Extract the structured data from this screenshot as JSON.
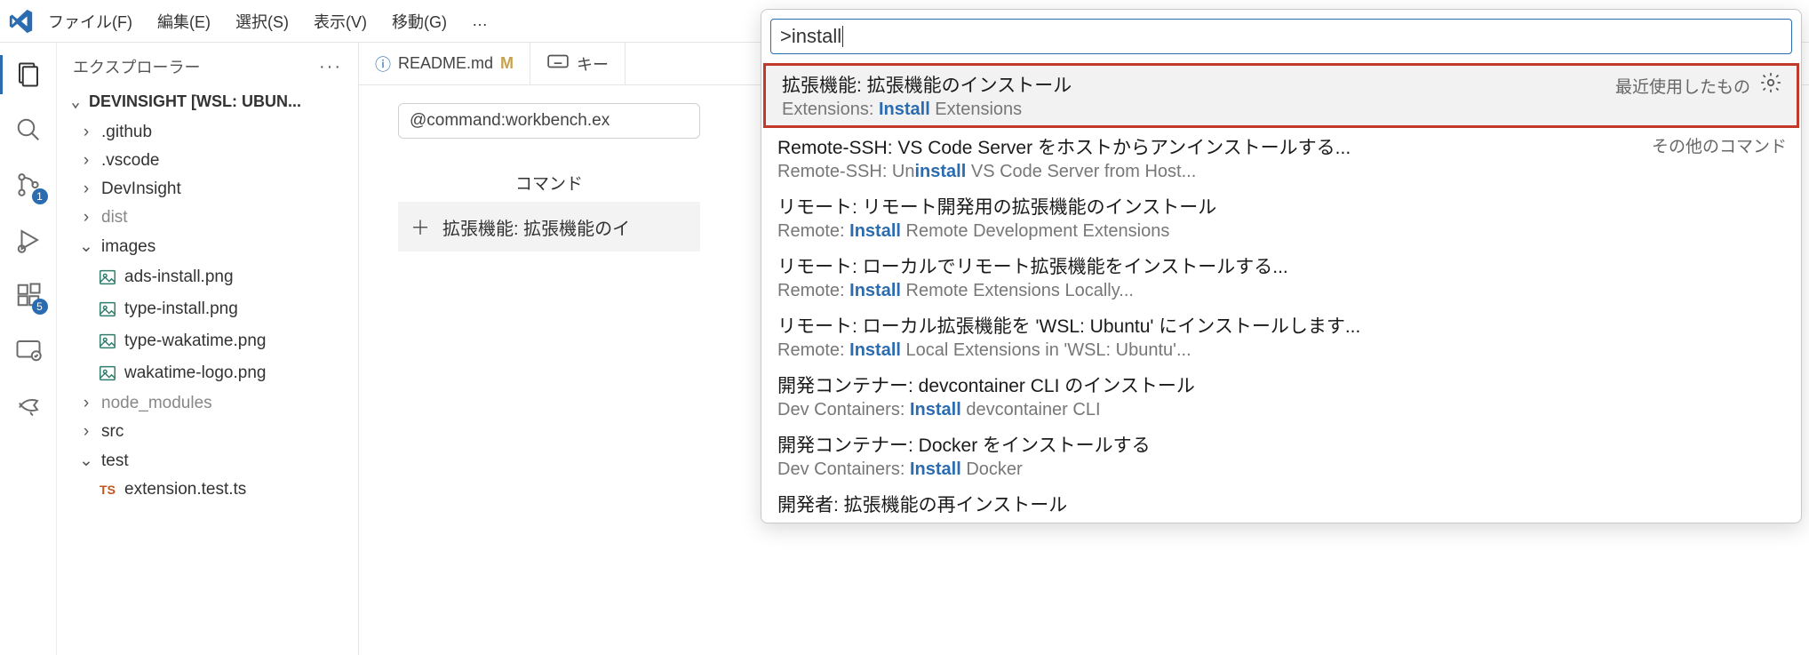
{
  "menu": {
    "file": "ファイル(F)",
    "edit": "編集(E)",
    "select": "選択(S)",
    "view": "表示(V)",
    "go": "移動(G)",
    "more": "…"
  },
  "activity": {
    "scm_badge": "1",
    "ext_badge": "5"
  },
  "sidebar": {
    "title": "エクスプローラー",
    "section": "DEVINSIGHT [WSL: UBUN...",
    "tree": {
      "github": ".github",
      "vscode": ".vscode",
      "devinsight": "DevInsight",
      "dist": "dist",
      "images": "images",
      "img1": "ads-install.png",
      "img2": "type-install.png",
      "img3": "type-wakatime.png",
      "img4": "wakatime-logo.png",
      "node_modules": "node_modules",
      "src": "src",
      "test": "test",
      "testfile": "extension.test.ts",
      "testfile_badge": "TS"
    }
  },
  "tabs": {
    "readme": "README.md",
    "readme_m": "M",
    "shortcuts": "キー"
  },
  "editor": {
    "filter": "@command:workbench.ex",
    "cmd_header": "コマンド",
    "cmd_row": "拡張機能: 拡張機能のイ"
  },
  "palette": {
    "input": ">install",
    "items": [
      {
        "main": "拡張機能: 拡張機能のインストール",
        "sub_pre": "Extensions: ",
        "sub_hl": "Install",
        "sub_post": " Extensions",
        "right": "最近使用したもの",
        "gear": true,
        "selected": true,
        "highlight": true
      },
      {
        "main": "Remote-SSH: VS Code Server をホストからアンインストールする...",
        "sub_pre": "Remote-SSH: Un",
        "sub_hl": "install",
        "sub_post": " VS Code Server from Host...",
        "right": "その他のコマンド"
      },
      {
        "main": "リモート: リモート開発用の拡張機能のインストール",
        "sub_pre": "Remote: ",
        "sub_hl": "Install",
        "sub_post": " Remote Development Extensions"
      },
      {
        "main": "リモート: ローカルでリモート拡張機能をインストールする...",
        "sub_pre": "Remote: ",
        "sub_hl": "Install",
        "sub_post": " Remote Extensions Locally..."
      },
      {
        "main": "リモート: ローカル拡張機能を 'WSL: Ubuntu' にインストールします...",
        "sub_pre": "Remote: ",
        "sub_hl": "Install",
        "sub_post": " Local Extensions in 'WSL: Ubuntu'..."
      },
      {
        "main": "開発コンテナー: devcontainer CLI のインストール",
        "sub_pre": "Dev Containers: ",
        "sub_hl": "Install",
        "sub_post": " devcontainer CLI"
      },
      {
        "main": "開発コンテナー: Docker をインストールする",
        "sub_pre": "Dev Containers: ",
        "sub_hl": "Install",
        "sub_post": " Docker"
      },
      {
        "main": "開発者: 拡張機能の再インストール",
        "sub_pre": "",
        "sub_hl": "",
        "sub_post": ""
      }
    ]
  }
}
